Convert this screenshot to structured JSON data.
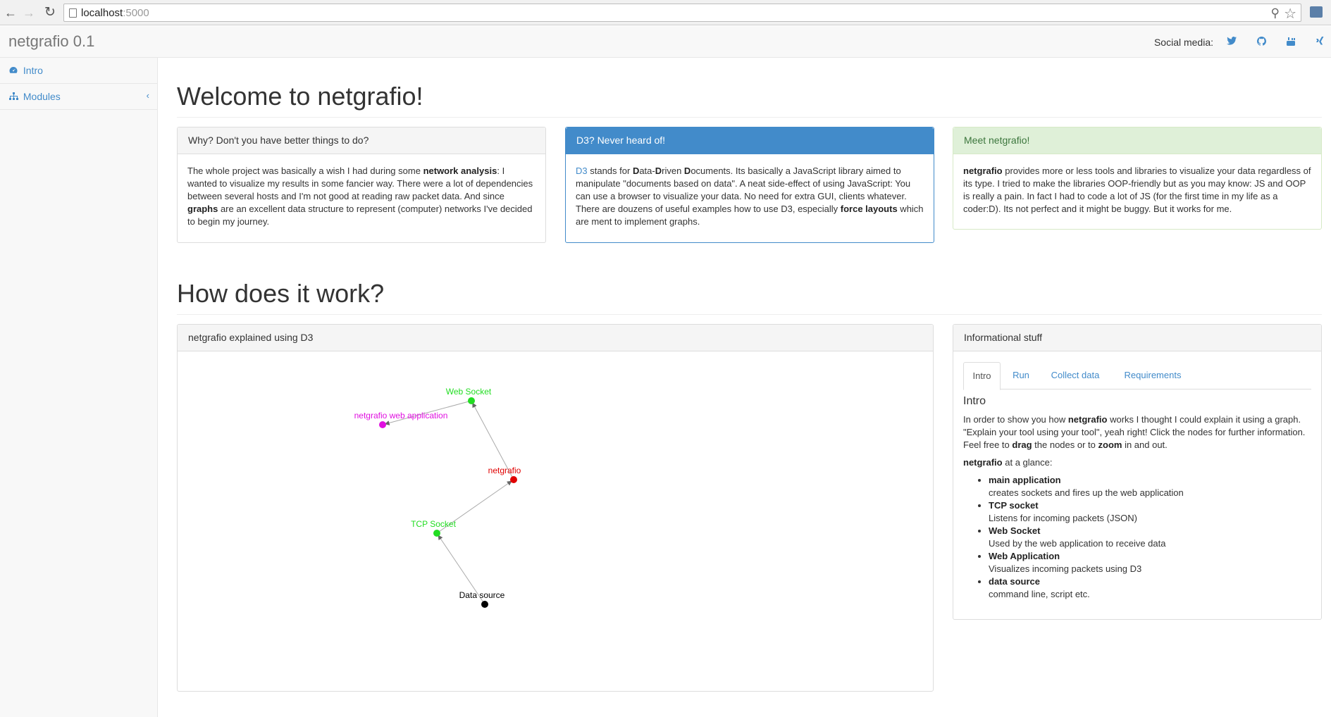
{
  "browser": {
    "url_host": "localhost",
    "url_port": ":5000"
  },
  "navbar": {
    "brand": "netgrafio 0.1",
    "social_label": "Social media:",
    "social_icons": [
      "twitter-icon",
      "github-icon",
      "youtube-icon",
      "xing-icon"
    ]
  },
  "sidebar": {
    "items": [
      {
        "label": "Intro",
        "icon": "dashboard-icon"
      },
      {
        "label": "Modules",
        "icon": "sitemap-icon"
      }
    ]
  },
  "main": {
    "title": "Welcome to netgrafio!",
    "panels": [
      {
        "heading": "Why? Don't you have better things to do?",
        "body": [
          {
            "t": "The whole project was basically a wish I had during some "
          },
          {
            "t": "network analysis",
            "b": true
          },
          {
            "t": ": I wanted to visualize my results in some fancier way. There were a lot of dependencies between several hosts and I'm not good at reading raw packet data. And since "
          },
          {
            "t": "graphs",
            "b": true
          },
          {
            "t": " are an excellent data structure to represent (computer) networks I've decided to begin my journey."
          }
        ]
      },
      {
        "heading": "D3? Never heard of!",
        "body": [
          {
            "t": "D3",
            "a": true
          },
          {
            "t": " stands for "
          },
          {
            "t": "D",
            "b": true
          },
          {
            "t": "ata-"
          },
          {
            "t": "D",
            "b": true
          },
          {
            "t": "riven "
          },
          {
            "t": "D",
            "b": true
          },
          {
            "t": "ocuments. Its basically a JavaScript library aimed to manipulate \"documents based on data\". A neat side-effect of using JavaScript: You can use a browser to visualize your data. No need for extra GUI, clients whatever. There are douzens of useful examples how to use D3, especially "
          },
          {
            "t": "force layouts",
            "b": true
          },
          {
            "t": " which are ment to implement graphs."
          }
        ]
      },
      {
        "heading": "Meet netgrafio!",
        "body": [
          {
            "t": "netgrafio",
            "b": true
          },
          {
            "t": " provides more or less tools and libraries to visualize your data regardless of its type. I tried to make the libraries OOP-friendly but as you may know: JS and OOP is really a pain. In fact I had to code a lot of JS (for the first time in my life as a coder:D). Its not perfect and it might be buggy. But it works for me."
          }
        ]
      }
    ],
    "section_title": "How does it work?",
    "graph_panel": {
      "heading": "netgrafio explained using D3",
      "nodes": [
        {
          "id": "web",
          "label": "Web Socket",
          "color": "#22dd22"
        },
        {
          "id": "app",
          "label": "netgrafio web application",
          "color": "#e010e0"
        },
        {
          "id": "ng",
          "label": "netgrafio",
          "color": "#e00000"
        },
        {
          "id": "tcp",
          "label": "TCP Socket",
          "color": "#22dd22"
        },
        {
          "id": "ds",
          "label": "Data source",
          "color": "#000000"
        }
      ],
      "links": [
        {
          "source": "ds",
          "target": "tcp"
        },
        {
          "source": "tcp",
          "target": "ng"
        },
        {
          "source": "ng",
          "target": "web"
        },
        {
          "source": "web",
          "target": "app"
        }
      ]
    },
    "info_panel": {
      "heading": "Informational stuff",
      "tabs": [
        "Intro",
        "Run",
        "Collect data",
        "Requirements"
      ],
      "active_tab": "Intro",
      "title": "Intro",
      "para1": [
        {
          "t": "In order to show you how "
        },
        {
          "t": "netgrafio",
          "b": true
        },
        {
          "t": " works I thought I could explain it using a graph. \"Explain your tool using your tool\", yeah right! Click the nodes for further information. Feel free to "
        },
        {
          "t": "drag",
          "b": true
        },
        {
          "t": " the nodes or to "
        },
        {
          "t": "zoom",
          "b": true
        },
        {
          "t": " in and out."
        }
      ],
      "glance_name": "netgrafio",
      "glance_suffix": " at a glance:",
      "items": [
        {
          "title": "main application",
          "desc": "creates sockets and fires up the web application"
        },
        {
          "title": "TCP socket",
          "desc": "Listens for incoming packets (JSON)"
        },
        {
          "title": "Web Socket",
          "desc": "Used by the web application to receive data"
        },
        {
          "title": "Web Application",
          "desc": "Visualizes incoming packets using D3"
        },
        {
          "title": "data source",
          "desc": "command line, script etc."
        }
      ]
    }
  }
}
